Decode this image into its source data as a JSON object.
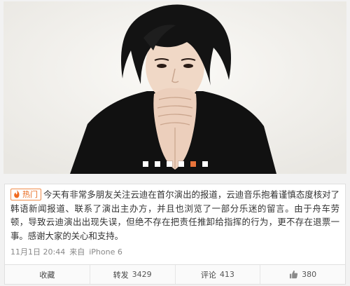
{
  "post": {
    "badge": "热门",
    "text": "今天有非常多朋友关注云迪在首尔演出的报道，云迪音乐抱着谨慎态度核对了韩语新闻报道、联系了演出主办方，并且也浏览了一部分乐迷的留言。由于舟车劳顿，导致云迪演出出现失误，但绝不存在把责任推卸给指挥的行为，更不存在退票一事。感谢大家的关心和支持。",
    "date": "11月1日 20:44",
    "source_prefix": "来自",
    "source": "iPhone 6"
  },
  "gallery": {
    "active_index": 4,
    "accent_color": "#e8743b",
    "dots": [
      "slide-1",
      "slide-2",
      "slide-3",
      "slide-4",
      "slide-5",
      "slide-6"
    ]
  },
  "actions": {
    "favorite_label": "收藏",
    "repost_label": "转发",
    "repost_count": "3429",
    "comment_label": "评论",
    "comment_count": "413",
    "like_count": "380"
  }
}
